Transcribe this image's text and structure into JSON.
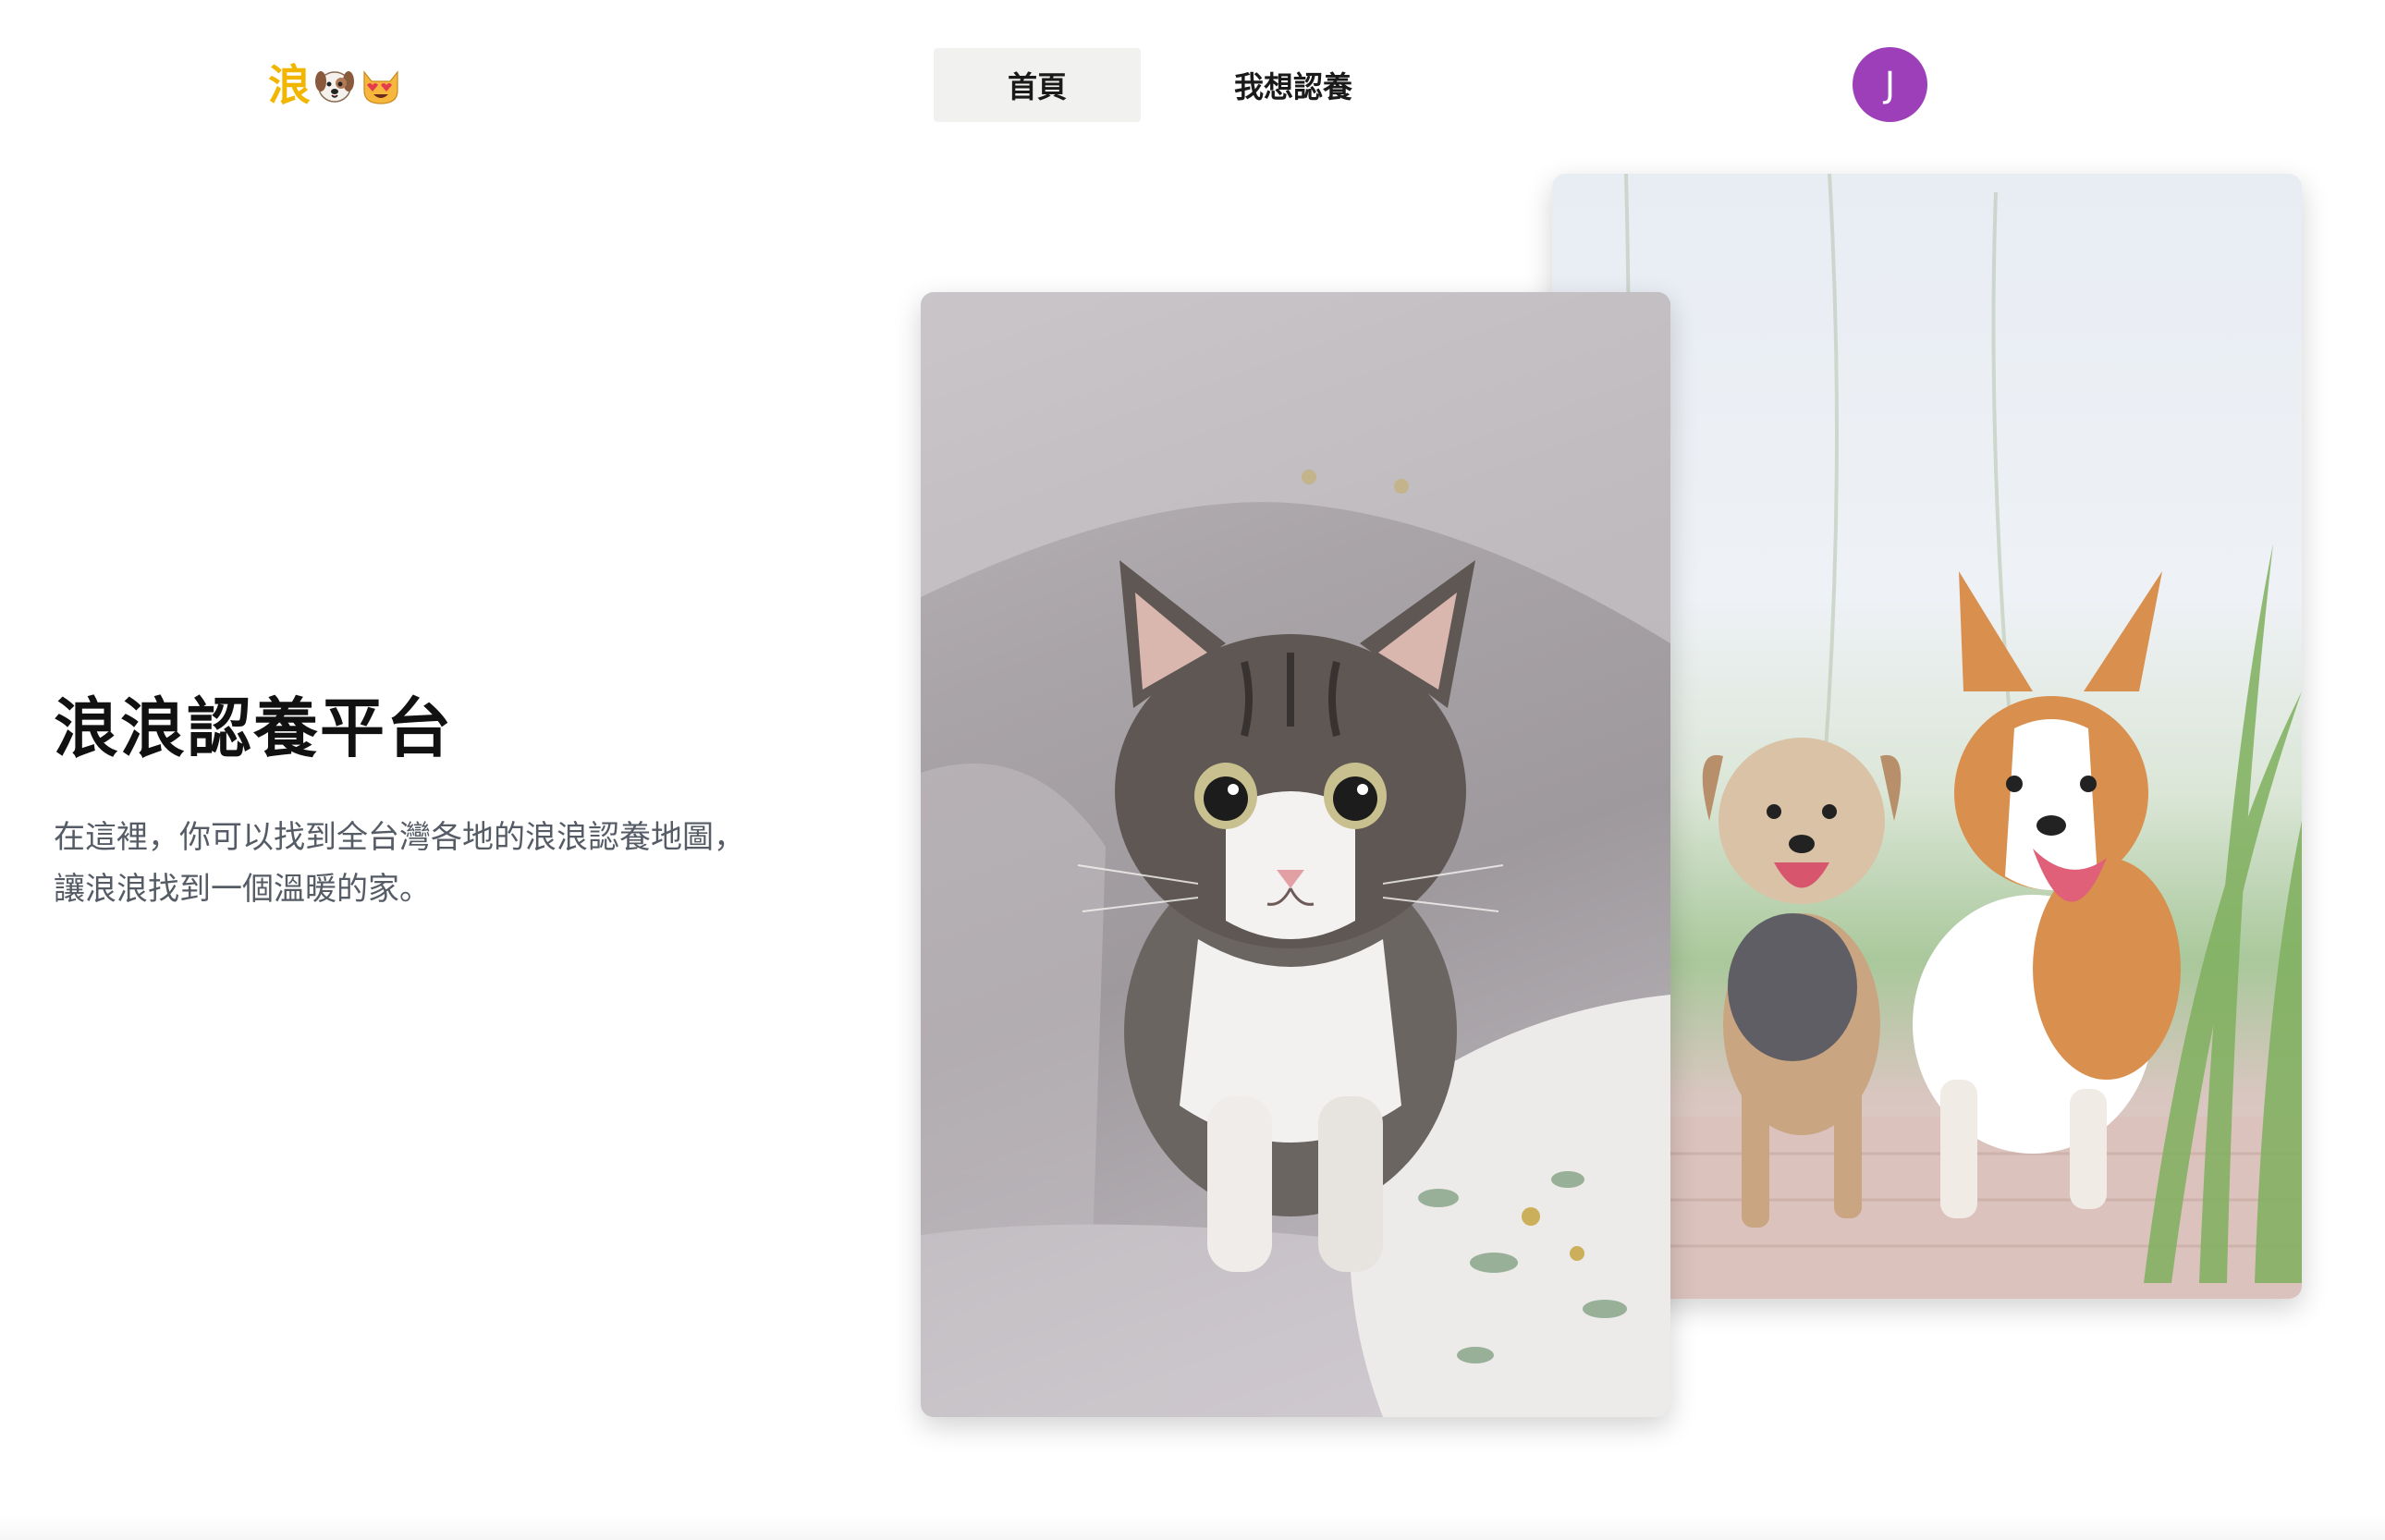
{
  "header": {
    "logo_text": "浪",
    "logo_icons": [
      "dog-face-icon",
      "heart-eyes-cat-icon"
    ],
    "nav_items": [
      {
        "label": "首頁",
        "active": true
      },
      {
        "label": "我想認養",
        "active": false
      }
    ],
    "avatar_initial": "J",
    "avatar_color": "#9c3fb8",
    "brand_color": "#f2b600"
  },
  "hero": {
    "title": "浪浪認養平台",
    "description_line1": "在這裡，你可以找到全台灣各地的浪浪認養地圖，",
    "description_line2": "讓浪浪找到一個溫暖的家。"
  },
  "images": {
    "front": "kitten-photo",
    "back": "dogs-running-photo"
  }
}
